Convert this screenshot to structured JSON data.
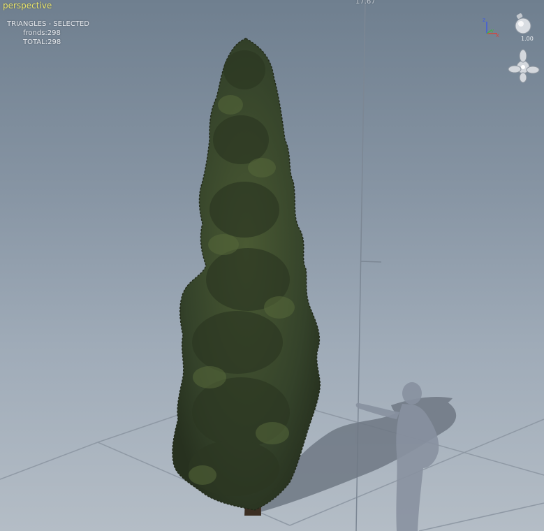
{
  "viewport": {
    "view_name": "perspective",
    "ruler_label": "17.67",
    "stats": {
      "heading": "TRIANGLES - SELECTED",
      "fronds_line": "fronds:298",
      "total_line": "TOTAL:298"
    },
    "widgets": {
      "axis_icon": "xyz-axis-gizmo-icon",
      "lightbulb_icon": "lightbulb-icon",
      "lightbulb_value": "1.00",
      "navigation_icon": "orbit-propeller-icon"
    },
    "axes_letters": {
      "x": "x",
      "y": "y",
      "z": "z"
    },
    "colors": {
      "sky_top": "#6f7f8f",
      "sky_bottom": "#b4bdc6",
      "foliage": "#3c4a2a",
      "foliage_dark": "#2a3420",
      "trunk": "#3b2e22",
      "shadow": "#6d7682",
      "view_name": "#e9e46a",
      "axis_x": "#d8433b",
      "axis_y": "#45b044",
      "axis_z": "#3f5be0"
    }
  }
}
